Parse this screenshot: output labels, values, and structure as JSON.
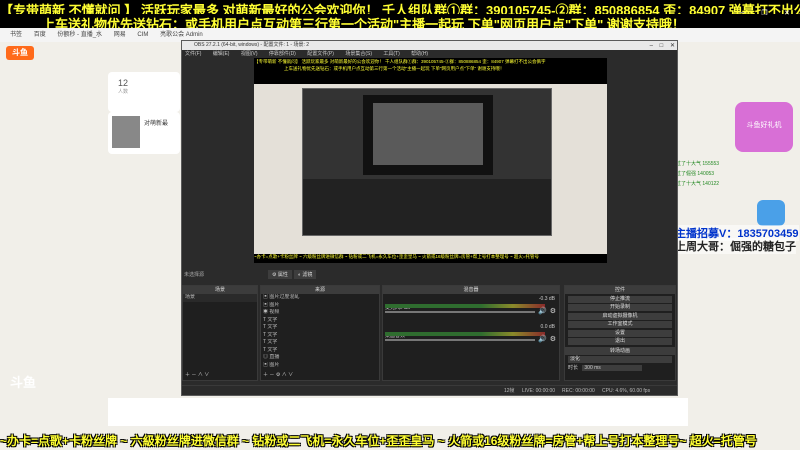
{
  "banner": {
    "line1": "【专带萌新 不懂就问 】 活跃玩家最多 对萌新最好的公会欢迎你！ 千人组队群①群：390105745-②群：850886854 歪：84907 弹幕打不出公会俩字",
    "line2": "上车送礼物优先送钻石：或手机用户点互动第三行第一个活动\"主播一起玩 下单\"网页用户点\"下单\" 谢谢支持哦！",
    "bottom": "~办卡=点歌+卡粉丝牌 ~ 六級粉丝牌进微信群 ~ 钻粉或二飞机=永久车位+歪歪皇马 ~ 火箭或16级粉丝牌=房管+帮上号打本整理号~ 超火=托管号"
  },
  "browser": {
    "bookmarks": [
      "书签",
      "百度",
      "份额秒 - 直播_水",
      "网易",
      "CIM",
      "亮歌公会 Admin"
    ]
  },
  "site": {
    "logo": "斗鱼",
    "count": "12",
    "count_label": "人数",
    "streamer_title": "对萌新最",
    "side_ad": "斗鱼好礼机",
    "watermark": "斗鱼"
  },
  "overlay": {
    "recruit": "主播招募V：1835703459",
    "last_week": "上周大哥：倔强的糖包子",
    "chat_lines": [
      "辅鱼惊动：能过了十大气 155553",
      "辅鱼惊动：能过了倔强 140053",
      "辅鱼惊动：能过了十大气 140122"
    ]
  },
  "obs": {
    "title": "OBS 27.2.1 (64-bit, windows) - 配置文件: 1 - 场景: 2",
    "menu": [
      "文件(F)",
      "编辑(E)",
      "视图(V)",
      "停靠部件(D)",
      "配置文件(P)",
      "场景集合(S)",
      "工具(T)",
      "帮助(H)"
    ],
    "inner_banner1": "【专带萌新 不懂就问】 活跃玩家最多 对萌新最好的公会欢迎你！ 千人组队群①群：390105745-②群：850886854 歪：84907 弹幕打不出公会俩字",
    "inner_banner2": "上车送礼物优先送钻石：或手机用户点互动第三行第一个活动\"主播一起玩 下单\"网页用户点\"下单\" 谢谢支持哦！",
    "inner_bottom": "~办卡=点歌+卡粉丝牌 ~ 六级粉丝牌进微信群 ~ 钻粉或二飞机=永久车位+歪歪皇马 ~ 火箭或16级粉丝牌=房管+帮上号打本整理号 ~ 超火=托管号",
    "source_label": "未选择源",
    "props_btn": "属性",
    "filters_btn": "滤镜",
    "docks": {
      "scenes": "场景",
      "sources": "来源",
      "mixer": "混音器",
      "transitions": "转场动画",
      "controls": "控件"
    },
    "scenes": [
      "场景"
    ],
    "sources": [
      "图片过度混乱",
      "图片",
      "视频",
      "文字",
      "文字",
      "文字",
      "文字",
      "文字",
      "直播",
      "图片",
      "文本 GDI+ 2"
    ],
    "mixer": [
      {
        "name": "麦克风/Aux",
        "db": "-0.3 dB"
      },
      {
        "name": "桌面音频",
        "db": "0.0 dB"
      }
    ],
    "transition_type": "淡化",
    "duration_label": "时长",
    "duration_value": "300 ms",
    "controls": [
      "停止推流",
      "开始录制",
      "启动虚拟摄像机",
      "工作室模式",
      "设置",
      "退出"
    ],
    "status": {
      "frames": "12帧",
      "live": "LIVE: 00:00:00",
      "rec": "REC: 00:00:00",
      "cpu": "CPU: 4.6%, 60.00 fps"
    }
  },
  "colors": {
    "banner_text": "#ffff33",
    "obs_bg": "#2b2b2b",
    "site_bg": "#f1efe9",
    "recruit_text": "#0033cc"
  }
}
